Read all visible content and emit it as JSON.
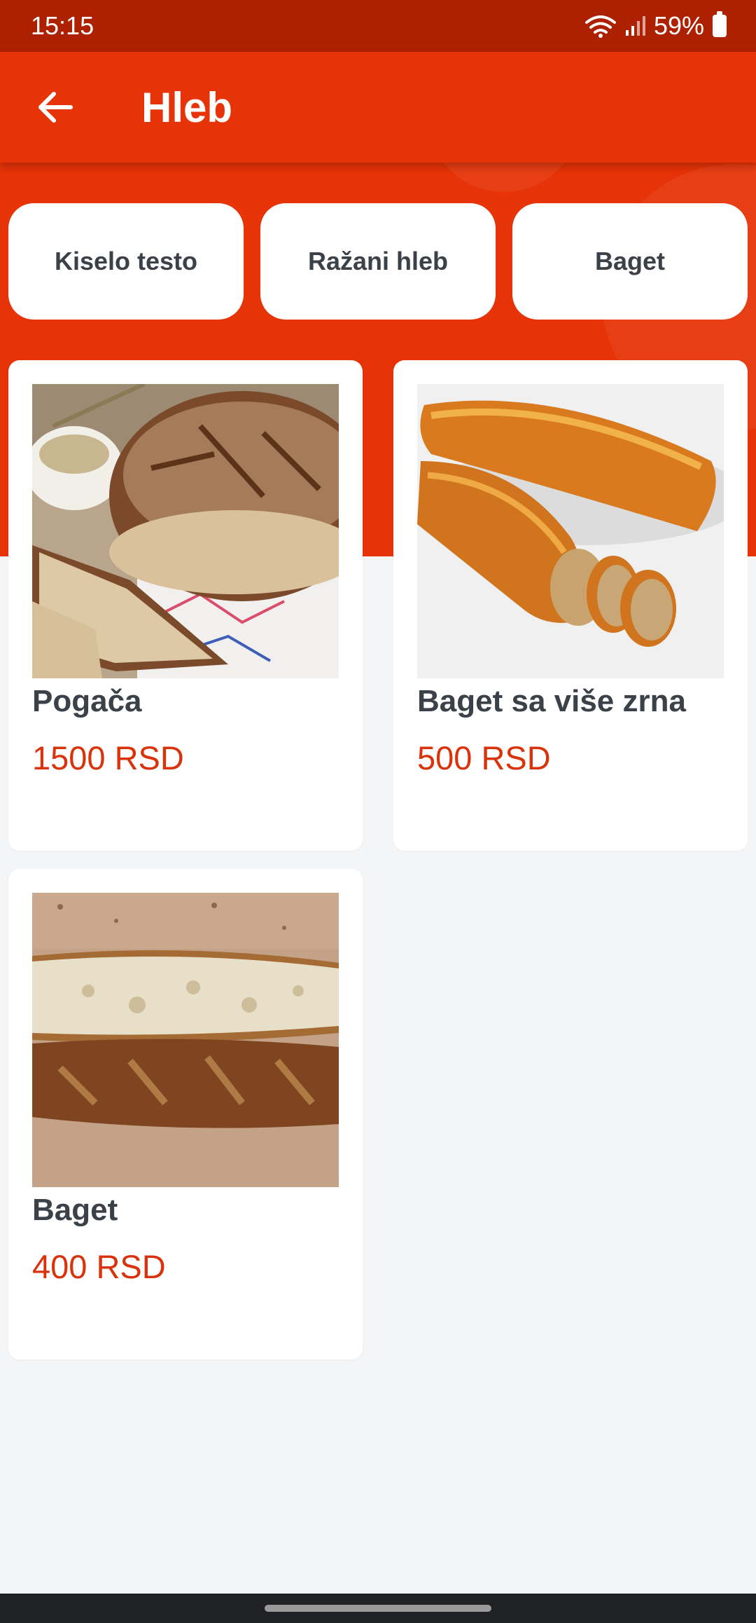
{
  "status_bar": {
    "time": "15:15",
    "battery": "59%"
  },
  "app_bar": {
    "title": "Hleb"
  },
  "chips": [
    {
      "label": "Kiselo testo"
    },
    {
      "label": "Ražani hleb"
    },
    {
      "label": "Baget"
    }
  ],
  "products": [
    {
      "name": "Pogača",
      "price": "1500 RSD"
    },
    {
      "name": "Baget sa više zrna",
      "price": "500 RSD"
    },
    {
      "name": "Baget",
      "price": "400 RSD"
    }
  ],
  "colors": {
    "primary": "#e63307",
    "status_bar": "#ad2000",
    "price": "#d9330c",
    "text": "#3b4149",
    "background": "#f4f5f7"
  }
}
